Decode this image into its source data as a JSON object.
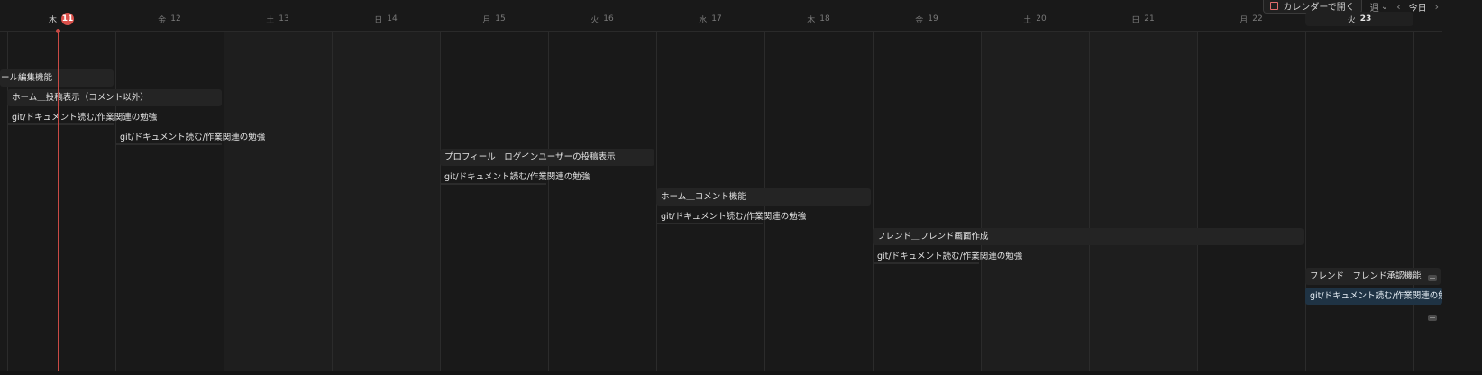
{
  "toolbar": {
    "open_calendar_label": "カレンダーで開く",
    "view_label": "週",
    "view_caret": "⌄",
    "prev_arrow": "‹",
    "next_arrow": "›",
    "today_label": "今日"
  },
  "days": [
    {
      "weekday": "木",
      "num": "11",
      "today": true
    },
    {
      "weekday": "金",
      "num": "12"
    },
    {
      "weekday": "土",
      "num": "13",
      "weekend": true
    },
    {
      "weekday": "日",
      "num": "14",
      "weekend": true
    },
    {
      "weekday": "月",
      "num": "15"
    },
    {
      "weekday": "火",
      "num": "16"
    },
    {
      "weekday": "水",
      "num": "17"
    },
    {
      "weekday": "木",
      "num": "18"
    },
    {
      "weekday": "金",
      "num": "19"
    },
    {
      "weekday": "土",
      "num": "20",
      "weekend": true
    },
    {
      "weekday": "日",
      "num": "21",
      "weekend": true
    },
    {
      "weekday": "月",
      "num": "22"
    },
    {
      "weekday": "火",
      "num": "23",
      "selected": true
    }
  ],
  "events": [
    {
      "title": "ール編集機能"
    },
    {
      "title": "ホーム＿投稿表示（コメント以外）"
    },
    {
      "title": "git/ドキュメント読む/作業関連の勉強"
    },
    {
      "title": "git/ドキュメント読む/作業関連の勉強"
    },
    {
      "title": "プロフィール＿ログインユーザーの投稿表示"
    },
    {
      "title": "git/ドキュメント読む/作業関連の勉強"
    },
    {
      "title": "ホーム＿コメント機能"
    },
    {
      "title": "git/ドキュメント読む/作業関連の勉強"
    },
    {
      "title": "フレンド＿フレンド画面作成"
    },
    {
      "title": "git/ドキュメント読む/作業関連の勉強"
    },
    {
      "title": "フレンド＿フレンド承認機能"
    },
    {
      "title": "git/ドキュメント読む/作業関連の勉強",
      "selected": true
    }
  ],
  "colors": {
    "background": "#191919",
    "today_marker": "#d9504a",
    "selected_event": "#1f3344"
  }
}
